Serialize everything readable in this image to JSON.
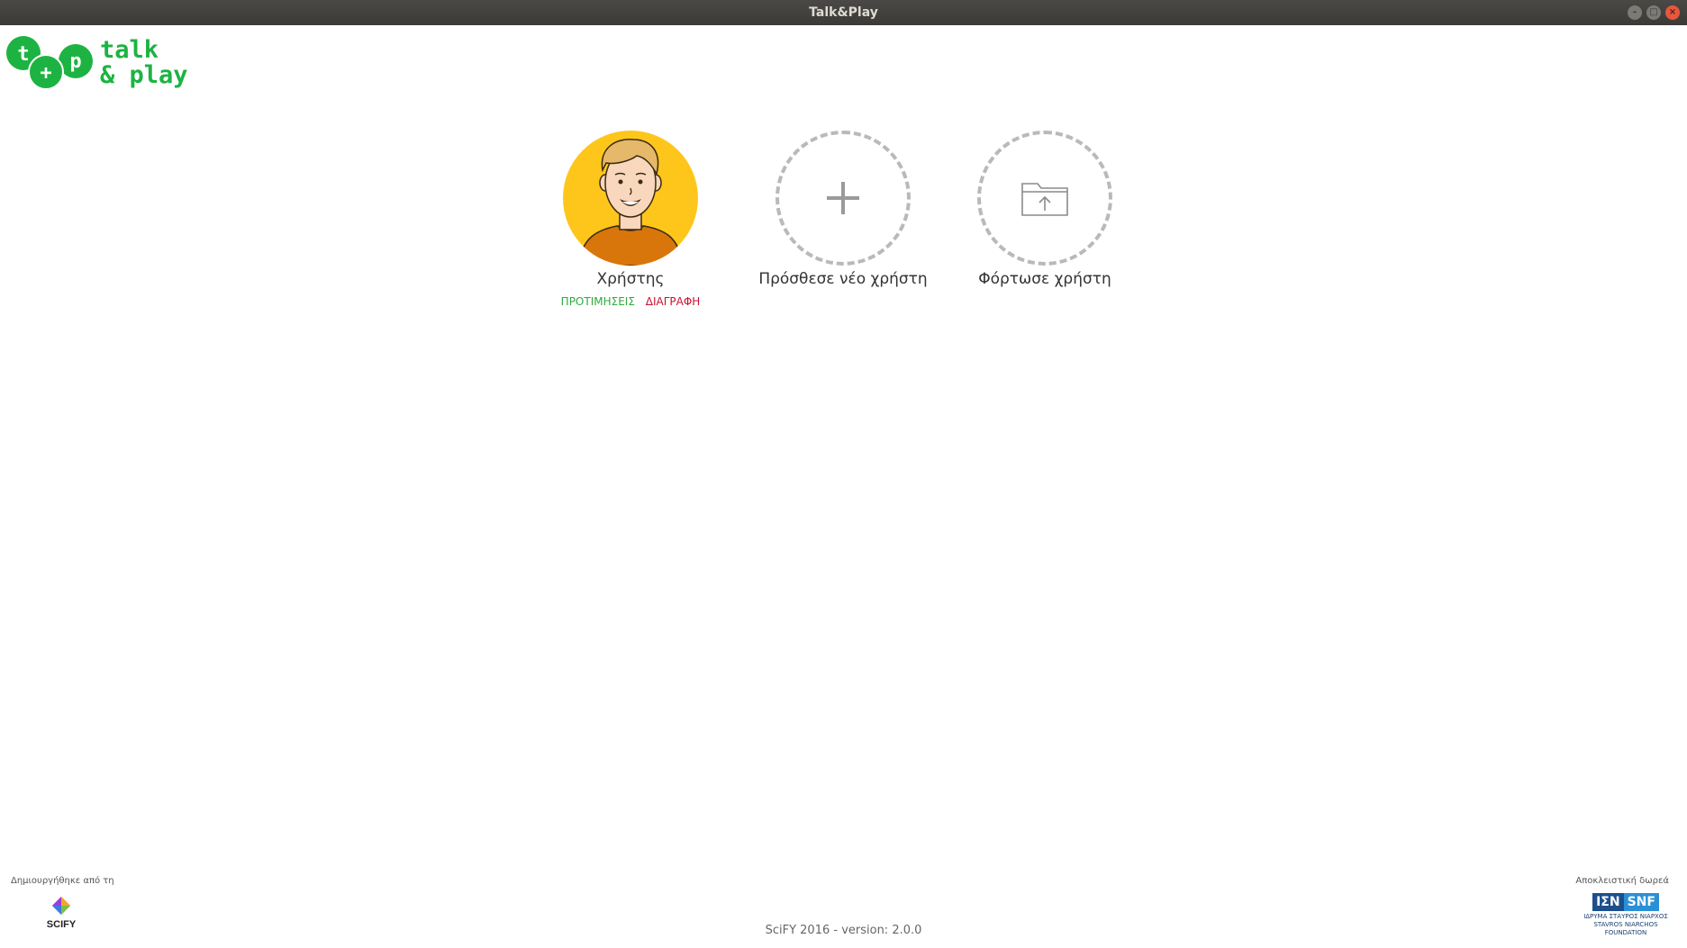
{
  "window": {
    "title": "Talk&Play",
    "controls": [
      "minimize",
      "maximize",
      "close"
    ]
  },
  "logo": {
    "mark_letters": [
      "t",
      "+",
      "p"
    ],
    "line1": "talk",
    "line2": "& play",
    "color": "#1db342"
  },
  "users": [
    {
      "name": "Χρήστης",
      "avatar": "cartoon-person-icon",
      "actions": {
        "preferences": "ΠΡΟΤΙΜΗΣΕΙΣ",
        "delete": "ΔΙΑΓΡΑΦΗ"
      }
    }
  ],
  "add_user": {
    "label": "Πρόσθεσε νέο χρήστη",
    "icon": "plus-icon"
  },
  "load_user": {
    "label": "Φόρτωσε χρήστη",
    "icon": "folder-upload-icon"
  },
  "footer": {
    "created_by": "Δημιουργήθηκε από τη",
    "creator_logo_text": "SCIFY",
    "version": "SciFY 2016 - version: 2.0.0",
    "donation": "Αποκλειστική δωρεά",
    "donor_logo": {
      "greek": "ΙΣΝ",
      "english": "SNF",
      "caption_line1": "ΙΔΡΥΜΑ ΣΤΑΥΡΟΣ ΝΙΑΡΧΟΣ",
      "caption_line2": "STAVROS NIARCHOS",
      "caption_line3": "FOUNDATION"
    }
  },
  "colors": {
    "accent_green": "#1db342",
    "preferences_green": "#2eaa3f",
    "delete_red": "#c8102e",
    "avatar_bg": "#fec61b"
  }
}
